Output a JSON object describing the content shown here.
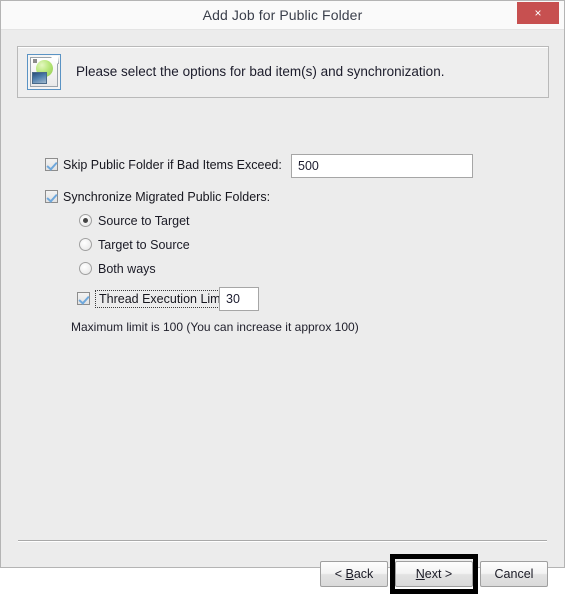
{
  "window": {
    "title": "Add Job for Public Folder",
    "close_label": "×",
    "close_icon": "close-icon",
    "accent_close": "#c75050",
    "background": "#ececec"
  },
  "header": {
    "icon": "document-image-icon",
    "instruction": "Please select the options for bad item(s) and synchronization."
  },
  "options": {
    "skip_bad_items": {
      "label": "Skip Public Folder if Bad Items Exceed:",
      "checked": true,
      "value": "500",
      "placeholder": ""
    },
    "synchronize": {
      "label": "Synchronize Migrated Public Folders:",
      "checked": true
    },
    "sync_direction": {
      "selected": "Source to Target",
      "choices": [
        {
          "label": "Source to Target",
          "selected": true
        },
        {
          "label": "Target to Source",
          "selected": false
        },
        {
          "label": "Both ways",
          "selected": false
        }
      ]
    },
    "thread_limit": {
      "label": "Thread Execution Limit :",
      "checked": true,
      "focused": true,
      "value": "30",
      "placeholder": ""
    },
    "hint": "Maximum limit is 100 (You can increase it approx 100)"
  },
  "footer": {
    "back_label": "< Back",
    "back_accel": "B",
    "next_label": "Next >",
    "next_accel": "N",
    "cancel_label": "Cancel",
    "next_highlighted": true,
    "highlight_color": "#000000"
  }
}
